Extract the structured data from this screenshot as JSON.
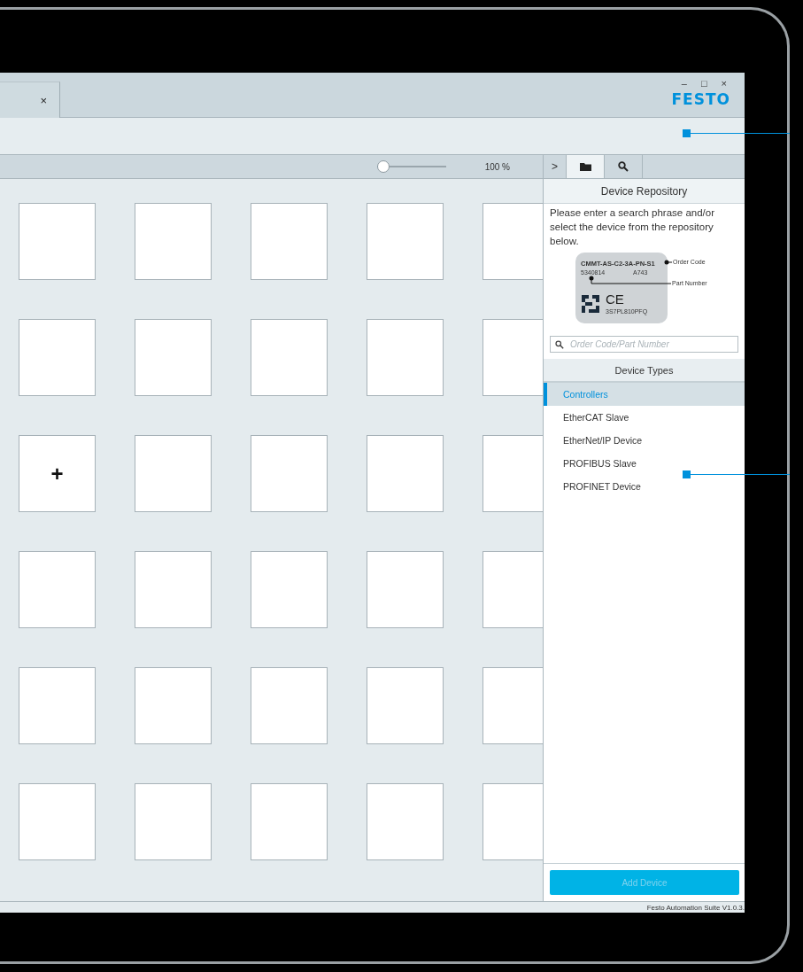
{
  "document_tabs": [
    {
      "close": "×",
      "selected": true
    }
  ],
  "window_controls": [
    "–",
    "□",
    "×"
  ],
  "logo": "FESTO",
  "zoom": {
    "level": 0.1,
    "reading": "100 %"
  },
  "tiles": [
    {
      "kind": "empty"
    },
    {
      "kind": "empty"
    },
    {
      "kind": "empty"
    },
    {
      "kind": "empty"
    },
    {
      "kind": "empty"
    },
    {
      "kind": "empty"
    },
    {
      "kind": "empty"
    },
    {
      "kind": "empty"
    },
    {
      "kind": "empty"
    },
    {
      "kind": "empty"
    },
    {
      "kind": "add",
      "label": "+"
    },
    {
      "kind": "empty"
    },
    {
      "kind": "empty"
    },
    {
      "kind": "empty"
    },
    {
      "kind": "empty"
    },
    {
      "kind": "empty"
    },
    {
      "kind": "empty"
    },
    {
      "kind": "empty"
    },
    {
      "kind": "empty"
    },
    {
      "kind": "empty"
    },
    {
      "kind": "empty"
    },
    {
      "kind": "empty"
    },
    {
      "kind": "empty"
    },
    {
      "kind": "empty"
    },
    {
      "kind": "empty"
    },
    {
      "kind": "empty"
    },
    {
      "kind": "empty"
    },
    {
      "kind": "empty"
    },
    {
      "kind": "empty"
    },
    {
      "kind": "empty"
    }
  ],
  "panel": {
    "collapse": ">",
    "tabs": [
      {
        "kind": "folder",
        "selected": true
      },
      {
        "kind": "search",
        "selected": false
      }
    ],
    "title": "Device Repository",
    "instructions": "Please enter a search phrase and/or select the device from the repository below.",
    "device_label": {
      "order_code": "CMMT-AS-C2-3A-PN-S1",
      "part_number": "5340814",
      "revision": "A743",
      "mark": "CE",
      "serial": "3S7PL810PFQ",
      "order_code_callout": "Order Code",
      "part_number_callout": "Part Number"
    },
    "search": {
      "placeholder": "Order Code/Part Number"
    },
    "types_title": "Device Types",
    "device_types": [
      {
        "label": "Controllers",
        "selected": true
      },
      {
        "label": "EtherCAT Slave",
        "selected": false
      },
      {
        "label": "EtherNet/IP Device",
        "selected": false
      },
      {
        "label": "PROFIBUS Slave",
        "selected": false
      },
      {
        "label": "PROFINET Device",
        "selected": false
      }
    ],
    "add_button": {
      "label": "Add Device",
      "disabled": true
    }
  },
  "status_bar": "Festo Automation Suite V1.0.3."
}
